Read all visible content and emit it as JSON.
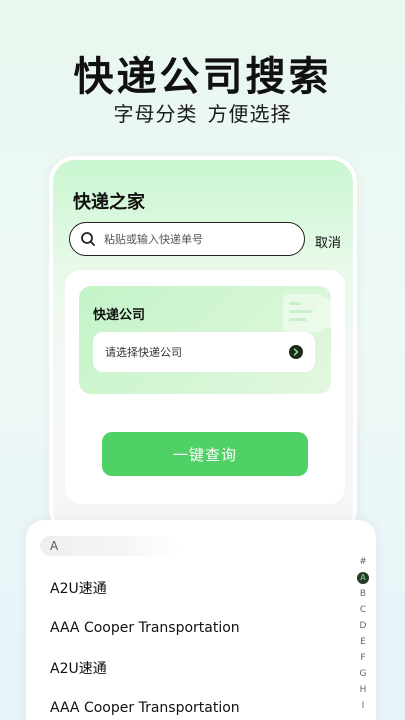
{
  "promo": {
    "headline": "快递公司搜索",
    "sub_left": "字母分类",
    "sub_right": "方便选择"
  },
  "app": {
    "title": "快递之家",
    "search": {
      "placeholder": "粘贴或输入快递单号"
    },
    "cancel_label": "取消",
    "company_card": {
      "label": "快递公司",
      "select_placeholder": "请选择快递公司"
    },
    "query_button": "一键查询"
  },
  "company_sheet": {
    "section": "A",
    "items": [
      "A2U速通",
      "AAA Cooper Transportation",
      "A2U速通",
      "AAA Cooper Transportation"
    ],
    "index": [
      "#",
      "A",
      "B",
      "C",
      "D",
      "E",
      "F",
      "G",
      "H",
      "I"
    ],
    "active_index": "A"
  },
  "colors": {
    "accent": "#4fd166",
    "dark": "#1f2a1f"
  }
}
